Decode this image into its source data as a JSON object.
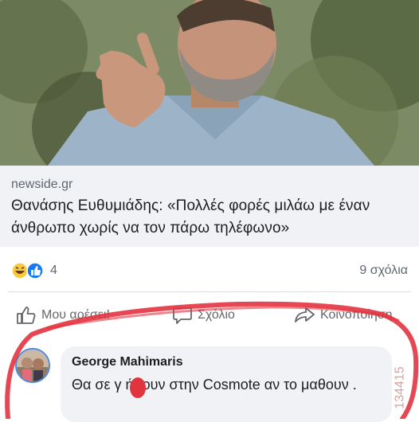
{
  "link_preview": {
    "image_icon": "man-gesturing-phone-call-photo",
    "source": "newside.gr",
    "headline": "Θανάσης Ευθυμιάδης: «Πολλές φορές μιλάω με έναν άνθρωπο χωρίς να τον πάρω τηλέφωνο»"
  },
  "reactions": {
    "icons": [
      "laugh-reaction-icon",
      "like-reaction-icon"
    ],
    "count": "4",
    "comments_count": "9 σχόλια"
  },
  "actions": {
    "like_label": "Μου αρέσει!",
    "comment_label": "Σχόλιο",
    "share_label": "Κοινοποίηση"
  },
  "comment": {
    "author": "George Mahimaris",
    "text": "Θα σε γ    ήσουν στην Cosmote αν το μαθουν ."
  },
  "watermark": "134415",
  "colors": {
    "link_title": "#1c1e21",
    "muted": "#606770",
    "preview_bg": "#f0f2f5",
    "annotation_red": "#e2343f",
    "like_blue": "#1877f2"
  }
}
